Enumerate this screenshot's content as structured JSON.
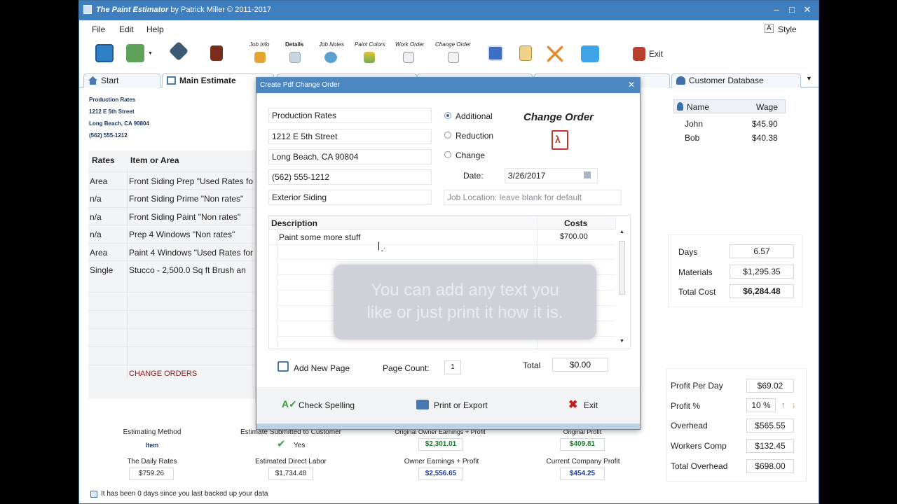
{
  "window": {
    "title_bold": "The Paint Estimator",
    "title_rest": "by Patrick Miller © 2011-2017",
    "style_label": "Style"
  },
  "menu": [
    "File",
    "Edit",
    "Help"
  ],
  "toolbar": {
    "labels": [
      "Job Info",
      "Details",
      "Job Notes",
      "Paint Colors",
      "Work Order",
      "Change Order"
    ],
    "exit_label": "Exit"
  },
  "tabs": {
    "start": "Start",
    "main": "Main Estimate",
    "customer": "Customer Database"
  },
  "address": [
    "Production Rates",
    "1212 E 5th Street",
    "Long Beach, CA 90804",
    "(562) 555-1212"
  ],
  "rates": {
    "headers": [
      "Rates",
      "Item or Area"
    ],
    "rows": [
      [
        "Area",
        "Front Siding Prep \"Used Rates fo"
      ],
      [
        "n/a",
        "Front Siding Prime \"Non rates\""
      ],
      [
        "n/a",
        "Front Siding Paint \"Non rates\""
      ],
      [
        "n/a",
        "Prep 4 Windows \"Non rates\""
      ],
      [
        "Area",
        "Paint 4 Windows \"Used Rates for"
      ],
      [
        "Single",
        "Stucco - 2,500.0 Sq ft Brush an"
      ]
    ],
    "change_orders": "CHANGE ORDERS"
  },
  "customers": {
    "headers": [
      "Name",
      "Wage"
    ],
    "rows": [
      [
        "John",
        "$45.90"
      ],
      [
        "Bob",
        "$40.38"
      ]
    ]
  },
  "stats": [
    [
      "Days",
      "6.57"
    ],
    [
      "Materials",
      "$1,295.35"
    ],
    [
      "Total Cost",
      "$6,284.48"
    ]
  ],
  "profit": [
    [
      "Profit Per Day",
      "$69.02"
    ],
    [
      "Profit %",
      "10 %"
    ],
    [
      "Overhead",
      "$565.55"
    ],
    [
      "Workers Comp",
      "$132.45"
    ],
    [
      "Total Overhead",
      "$698.00"
    ]
  ],
  "bottom": {
    "estimating_method": "Estimating Method",
    "item": "Item",
    "submitted": "Estimate Submitted to Customer",
    "yes": "Yes",
    "orig_owner": "Original Owner Earnings + Profit",
    "orig_owner_val": "$2,301.01",
    "orig_profit": "Original Profit",
    "orig_profit_val": "$409.81",
    "daily_rates": "The Daily Rates",
    "daily_rates_val": "$759.26",
    "direct_labor": "Estimated Direct Labor",
    "direct_labor_val": "$1,734.48",
    "owner_earn": "Owner Earnings +  Profit",
    "owner_earn_val": "$2,556.65",
    "company_profit": "Current Company Profit",
    "company_profit_val": "$454.25",
    "backup": "It has been 0 days since you last backed up your data"
  },
  "dialog": {
    "title": "Create Pdf Change Order",
    "fields": [
      "Production Rates",
      "1212 E 5th Street",
      "Long Beach, CA 90804",
      "(562) 555-1212",
      "Exterior Siding"
    ],
    "radios": [
      "Additional",
      "Reduction",
      "Change"
    ],
    "heading": "Change Order",
    "date_label": "Date:",
    "date": "3/26/2017",
    "job_location_placeholder": "Job Location: leave blank for default",
    "grid_headers": [
      "Description",
      "Costs"
    ],
    "grid_rows": [
      [
        "Paint some more stuff",
        "$700.00"
      ]
    ],
    "overlay": [
      "You can add any text you",
      "like or just print it how it is."
    ],
    "add_page": "Add New Page",
    "page_count_label": "Page Count:",
    "page_count": "1",
    "total_label": "Total",
    "total": "$0.00",
    "check_spelling": "Check Spelling",
    "print_export": "Print or Export",
    "exit": "Exit"
  },
  "colors": {
    "accent": "#3f7fbf",
    "change_orders": "#8b1a1a",
    "pdf": "#c0392b"
  }
}
